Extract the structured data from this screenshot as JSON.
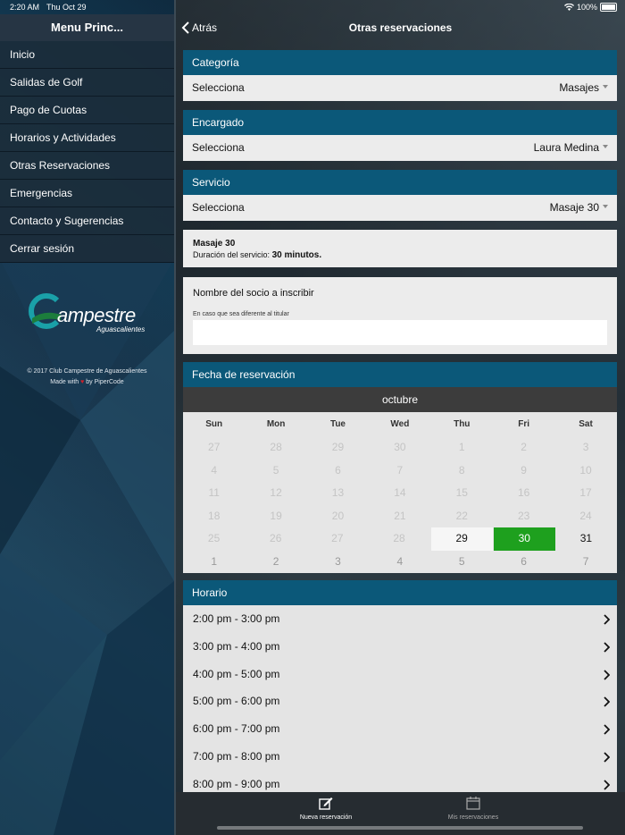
{
  "status_bar": {
    "time": "2:20 AM",
    "date": "Thu Oct 29",
    "battery": "100%"
  },
  "sidebar": {
    "title": "Menu Princ...",
    "items": [
      {
        "label": "Inicio"
      },
      {
        "label": "Salidas de Golf"
      },
      {
        "label": "Pago de Cuotas"
      },
      {
        "label": "Horarios y Actividades"
      },
      {
        "label": "Otras Reservaciones"
      },
      {
        "label": "Emergencias"
      },
      {
        "label": "Contacto y Sugerencias"
      },
      {
        "label": "Cerrar sesión"
      }
    ],
    "logo": {
      "text": "ampestre",
      "subtext": "Aguascalientes"
    },
    "copyright": "© 2017 Club Campestre de Aguascalientes",
    "made_with_prefix": "Made with",
    "made_with_suffix": "by PiperCode"
  },
  "navbar": {
    "back_label": "Atrás",
    "title": "Otras reservaciones"
  },
  "categoria": {
    "header": "Categoría",
    "label": "Selecciona",
    "value": "Masajes"
  },
  "encargado": {
    "header": "Encargado",
    "label": "Selecciona",
    "value": "Laura Medina"
  },
  "servicio": {
    "header": "Servicio",
    "label": "Selecciona",
    "value": "Masaje 30"
  },
  "info": {
    "name": "Masaje 30",
    "duration_prefix": "Duración del servicio:",
    "duration_value": "30 minutos."
  },
  "socio": {
    "title": "Nombre del socio a inscribir",
    "hint": "En caso que sea diferente al titular",
    "value": ""
  },
  "fecha": {
    "header": "Fecha de reservación",
    "month": "octubre",
    "weekdays": [
      "Sun",
      "Mon",
      "Tue",
      "Wed",
      "Thu",
      "Fri",
      "Sat"
    ],
    "weeks": [
      [
        "27",
        "28",
        "29",
        "30",
        "1",
        "2",
        "3"
      ],
      [
        "4",
        "5",
        "6",
        "7",
        "8",
        "9",
        "10"
      ],
      [
        "11",
        "12",
        "13",
        "14",
        "15",
        "16",
        "17"
      ],
      [
        "18",
        "19",
        "20",
        "21",
        "22",
        "23",
        "24"
      ],
      [
        "25",
        "26",
        "27",
        "28",
        "29",
        "30",
        "31"
      ],
      [
        "1",
        "2",
        "3",
        "4",
        "5",
        "6",
        "7"
      ]
    ],
    "today": "29",
    "selected": "30"
  },
  "horario": {
    "header": "Horario",
    "slots": [
      "2:00 pm - 3:00 pm",
      "3:00 pm - 4:00 pm",
      "4:00 pm - 5:00 pm",
      "5:00 pm - 6:00 pm",
      "6:00 pm - 7:00 pm",
      "7:00 pm - 8:00 pm",
      "8:00 pm - 9:00 pm"
    ]
  },
  "tabbar": {
    "tabs": [
      {
        "label": "Nueva reservación",
        "icon": "edit-icon"
      },
      {
        "label": "Mis reservaciones",
        "icon": "calendar-icon"
      }
    ]
  },
  "colors": {
    "header_blue": "#0b5879",
    "selected_green": "#1ea01e"
  }
}
